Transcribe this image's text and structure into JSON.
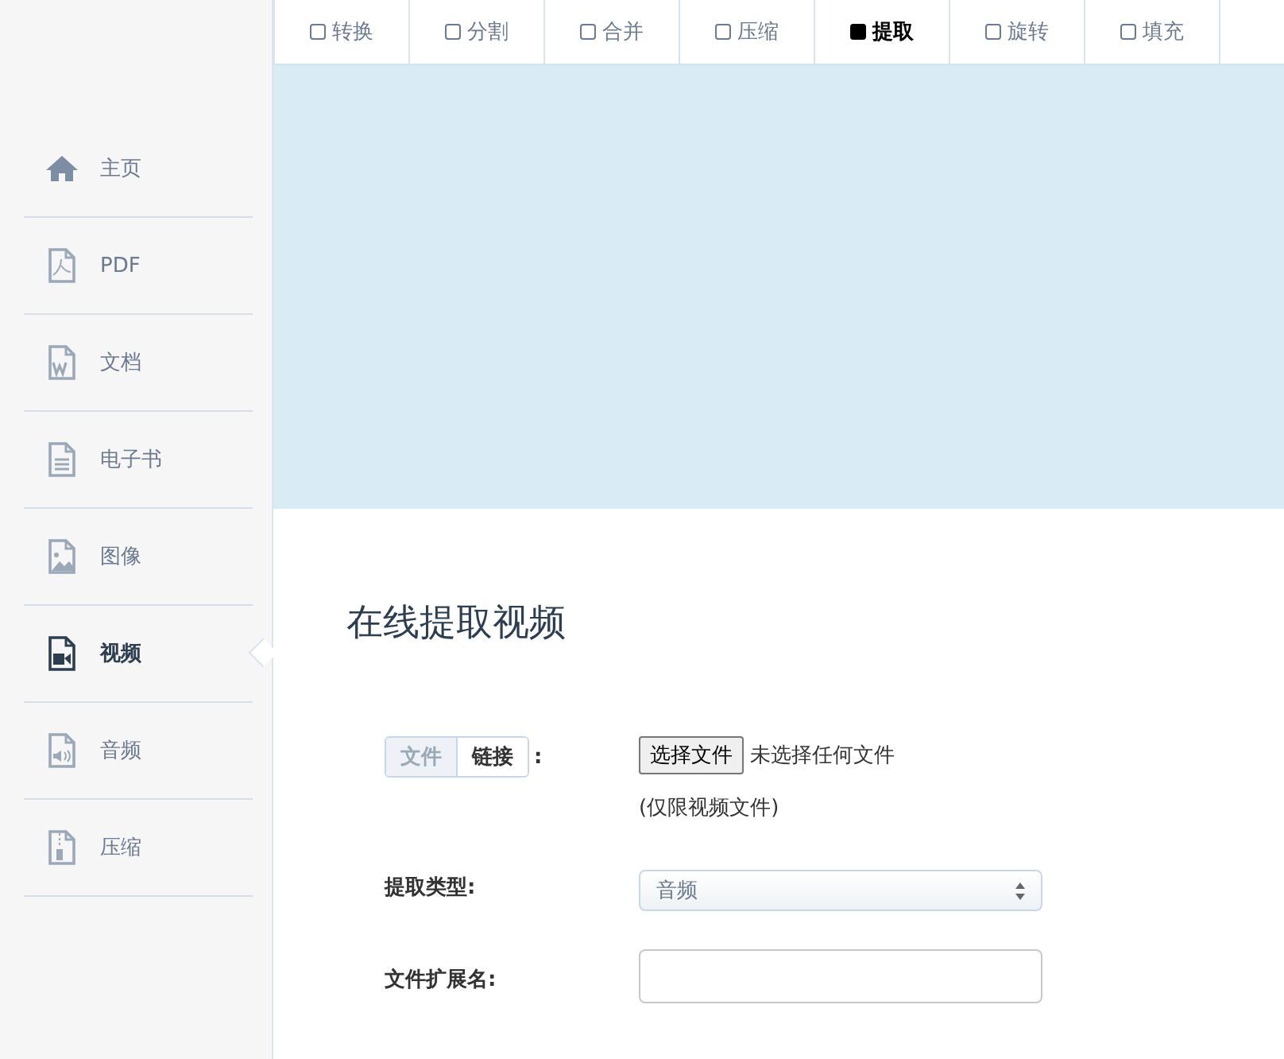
{
  "tabs": [
    {
      "label": "转换",
      "selected": false
    },
    {
      "label": "分割",
      "selected": false
    },
    {
      "label": "合并",
      "selected": false
    },
    {
      "label": "压缩",
      "selected": false
    },
    {
      "label": "提取",
      "selected": true
    },
    {
      "label": "旋转",
      "selected": false
    },
    {
      "label": "填充",
      "selected": false
    }
  ],
  "sidebar": {
    "items": [
      {
        "kind": "home",
        "label": "主页",
        "selected": false
      },
      {
        "kind": "pdf",
        "label": "PDF",
        "selected": false
      },
      {
        "kind": "word",
        "label": "文档",
        "selected": false
      },
      {
        "kind": "doc",
        "label": "电子书",
        "selected": false
      },
      {
        "kind": "image",
        "label": "图像",
        "selected": false
      },
      {
        "kind": "video",
        "label": "视频",
        "selected": true
      },
      {
        "kind": "audio",
        "label": "音频",
        "selected": false
      },
      {
        "kind": "zip",
        "label": "压缩",
        "selected": false
      }
    ]
  },
  "page_title": "在线提取视频",
  "form": {
    "source_toggle": [
      {
        "label": "文件",
        "selected": true
      },
      {
        "label": "链接",
        "selected": false
      }
    ],
    "source_colon": ":",
    "file_button": "选择文件",
    "file_status": "未选择任何文件",
    "file_hint": "(仅限视频文件)",
    "type_label": "提取类型:",
    "type_value": "音频",
    "ext_label": "文件扩展名:"
  }
}
